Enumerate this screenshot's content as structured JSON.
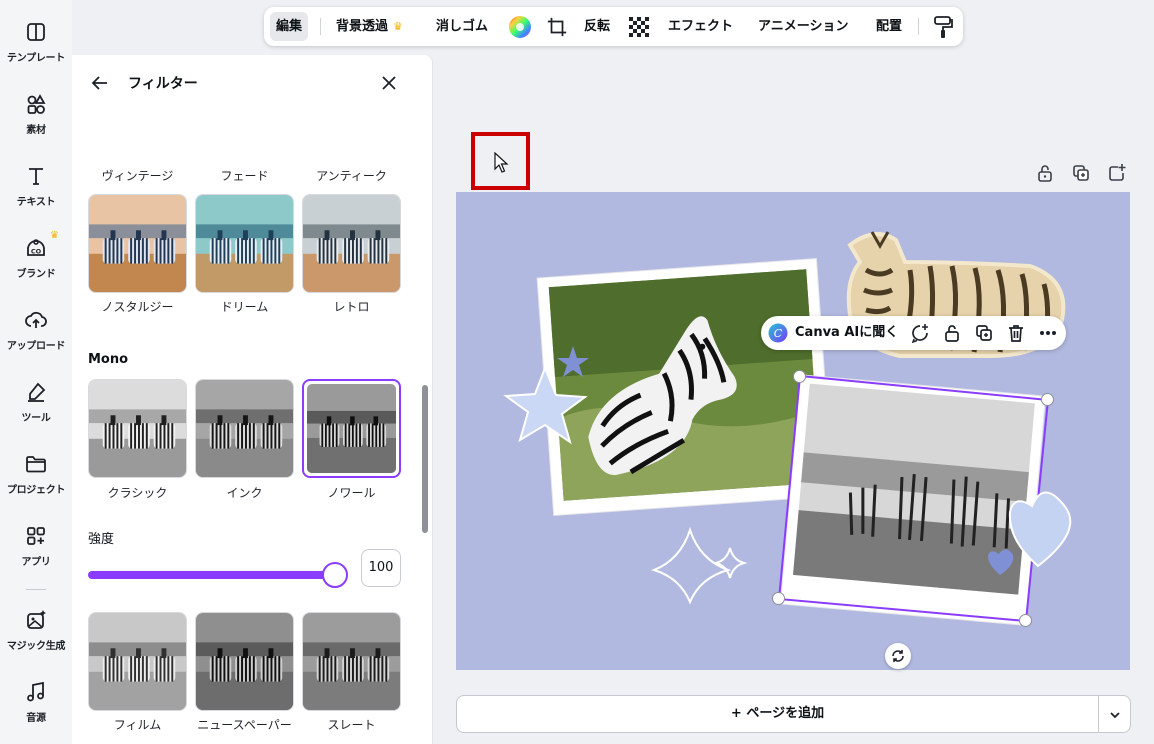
{
  "rail": {
    "items": [
      {
        "label": "テンプレート",
        "icon": "template-icon"
      },
      {
        "label": "素材",
        "icon": "elements-icon"
      },
      {
        "label": "テキスト",
        "icon": "text-icon"
      },
      {
        "label": "ブランド",
        "icon": "brand-icon"
      },
      {
        "label": "アップロード",
        "icon": "upload-icon"
      },
      {
        "label": "ツール",
        "icon": "tools-icon"
      },
      {
        "label": "プロジェクト",
        "icon": "folder-icon"
      },
      {
        "label": "アプリ",
        "icon": "apps-icon"
      },
      {
        "label": "マジック生成",
        "icon": "magic-media-icon"
      },
      {
        "label": "音源",
        "icon": "music-icon"
      }
    ]
  },
  "panel": {
    "title": "フィルター",
    "tiles": [
      {
        "label": "ヴィンテージ",
        "tone": "vintage"
      },
      {
        "label": "フェード",
        "tone": "fade"
      },
      {
        "label": "アンティーク",
        "tone": "antique"
      },
      {
        "label": "ノスタルジー",
        "tone": "nostalgia"
      },
      {
        "label": "ドリーム",
        "tone": "dream"
      },
      {
        "label": "レトロ",
        "tone": "retro"
      },
      {
        "label": "クラシック",
        "tone": "mono-light"
      },
      {
        "label": "インク",
        "tone": "mono-ink"
      },
      {
        "label": "ノワール",
        "tone": "mono-noir"
      },
      {
        "label": "フィルム",
        "tone": "mono-film"
      },
      {
        "label": "ニュースペーパー",
        "tone": "mono-news"
      },
      {
        "label": "スレート",
        "tone": "mono-slate"
      }
    ],
    "mono_section": "Mono",
    "strength_label": "強度",
    "strength_value": "100",
    "strength_fraction": 1.0
  },
  "toolbar": {
    "edit": "編集",
    "bg_remove": "背景透過",
    "eraser": "消しゴム",
    "flip": "反転",
    "effects": "エフェクト",
    "animation": "アニメーション",
    "position": "配置"
  },
  "floating": {
    "ai_label": "Canva AIに聞く"
  },
  "add_page": "+ ページを追加",
  "colors": {
    "accent": "#8b3dff",
    "canvas_bg": "#b1b9e0",
    "highlight": "#cc0000"
  }
}
